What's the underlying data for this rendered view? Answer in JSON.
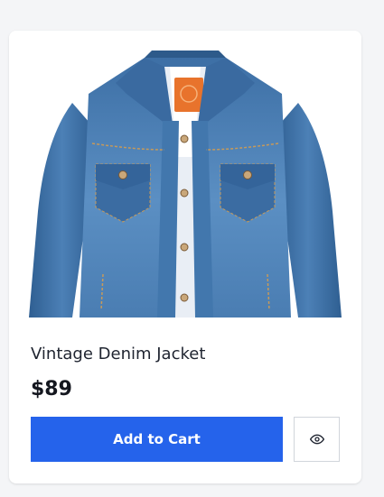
{
  "product": {
    "name": "Vintage Denim Jacket",
    "price": "$89",
    "image_icon": "denim-jacket-image"
  },
  "actions": {
    "add_to_cart_label": "Add to Cart",
    "view_icon": "eye-icon"
  },
  "colors": {
    "primary": "#2563eb",
    "denim": "#3f73a8",
    "denim_dark": "#2a5583",
    "tag": "#e8732c",
    "page_bg": "#f4f5f7"
  }
}
